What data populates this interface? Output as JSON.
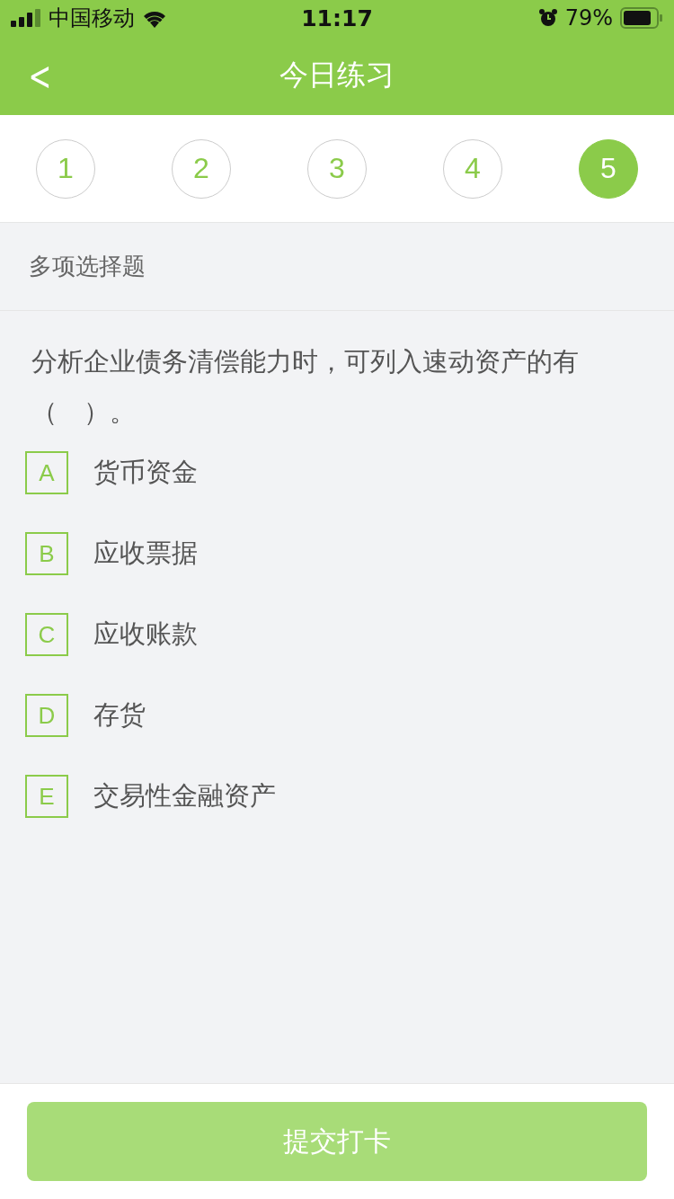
{
  "status_bar": {
    "carrier": "中国移动",
    "time": "11:17",
    "battery": "79%"
  },
  "nav": {
    "back": "<",
    "title": "今日练习"
  },
  "questions": [
    {
      "label": "1",
      "selected": false
    },
    {
      "label": "2",
      "selected": false
    },
    {
      "label": "3",
      "selected": false
    },
    {
      "label": "4",
      "selected": false
    },
    {
      "label": "5",
      "selected": true
    }
  ],
  "question_type": "多项选择题",
  "question": "分析企业债务清偿能力时，可列入速动资产的有（　）。",
  "options": [
    {
      "letter": "A",
      "text": "货币资金",
      "selected": false
    },
    {
      "letter": "B",
      "text": "应收票据",
      "selected": false
    },
    {
      "letter": "C",
      "text": "应收账款",
      "selected": false
    },
    {
      "letter": "D",
      "text": "存货",
      "selected": false
    },
    {
      "letter": "E",
      "text": "交易性金融资产",
      "selected": false
    }
  ],
  "submit": {
    "label": "提交打卡",
    "disabled": true
  }
}
